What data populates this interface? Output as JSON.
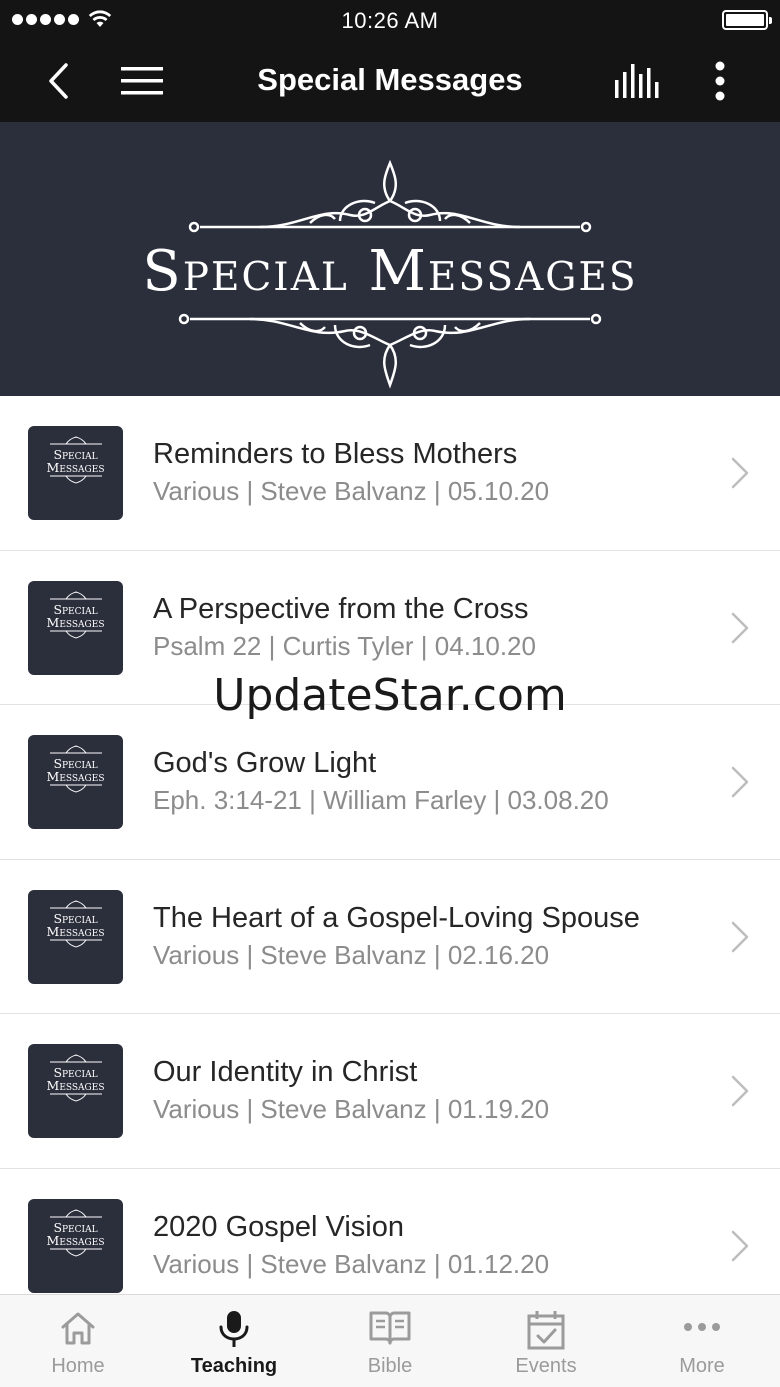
{
  "status": {
    "time": "10:26 AM"
  },
  "nav": {
    "title": "Special Messages"
  },
  "banner": {
    "title": "Special Messages"
  },
  "thumb_text": {
    "line1": "Special",
    "line2": "Messages"
  },
  "items": [
    {
      "title": "Reminders to Bless Mothers",
      "subtitle": "Various | Steve Balvanz | 05.10.20"
    },
    {
      "title": "A Perspective from the Cross",
      "subtitle": "Psalm 22 | Curtis Tyler | 04.10.20"
    },
    {
      "title": "God's Grow Light",
      "subtitle": "Eph. 3:14-21 | William Farley | 03.08.20"
    },
    {
      "title": "The Heart of a Gospel-Loving Spouse",
      "subtitle": "Various | Steve Balvanz | 02.16.20"
    },
    {
      "title": "Our Identity in Christ",
      "subtitle": "Various | Steve Balvanz | 01.19.20"
    },
    {
      "title": "2020 Gospel Vision",
      "subtitle": "Various | Steve Balvanz | 01.12.20"
    }
  ],
  "watermark": "UpdateStar.com",
  "tabs": [
    {
      "label": "Home",
      "icon": "home-icon"
    },
    {
      "label": "Teaching",
      "icon": "microphone-icon",
      "active": true
    },
    {
      "label": "Bible",
      "icon": "book-icon"
    },
    {
      "label": "Events",
      "icon": "calendar-check-icon"
    },
    {
      "label": "More",
      "icon": "more-dots-icon"
    }
  ],
  "colors": {
    "bar": "#141414",
    "banner": "#2b2e3b",
    "title": "#262626",
    "subtitle": "#8c8c8c",
    "tab_inactive": "#9b9b9b"
  }
}
